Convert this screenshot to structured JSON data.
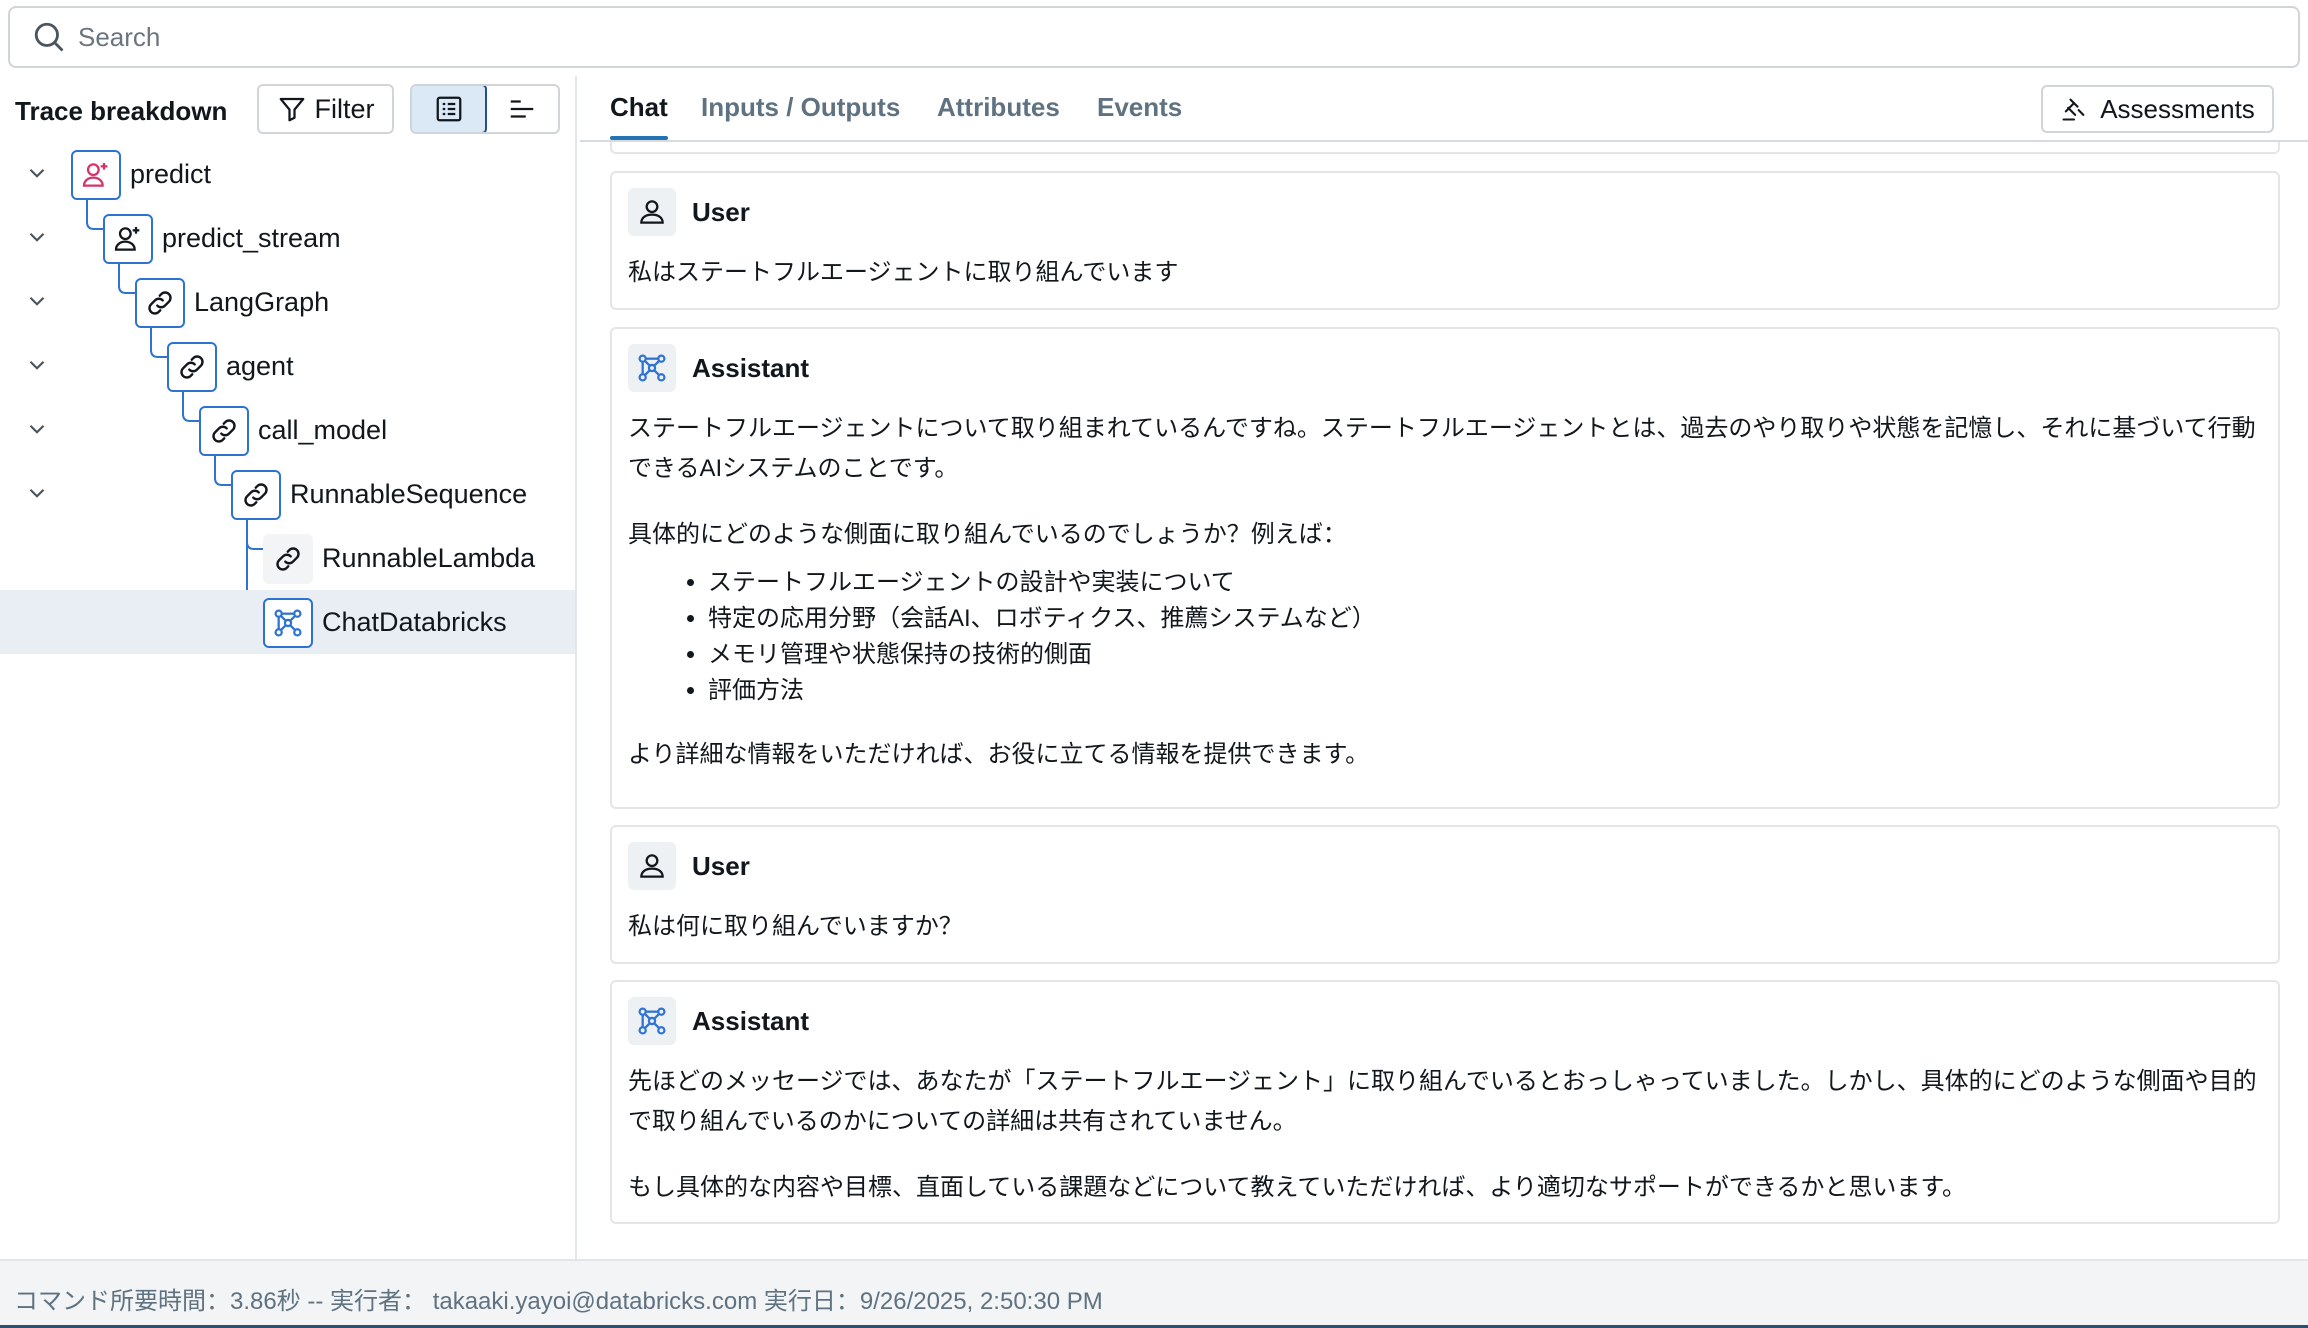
{
  "search": {
    "placeholder": "Search"
  },
  "left_panel": {
    "title": "Trace breakdown",
    "filter_label": "Filter",
    "view_modes": [
      "tree-view",
      "timeline-view"
    ]
  },
  "tree": [
    {
      "label": "predict",
      "icon": "agent-icon",
      "expanded": true
    },
    {
      "label": "predict_stream",
      "icon": "agent-icon",
      "expanded": true
    },
    {
      "label": "LangGraph",
      "icon": "link-icon",
      "expanded": true
    },
    {
      "label": "agent",
      "icon": "link-icon",
      "expanded": true
    },
    {
      "label": "call_model",
      "icon": "link-icon",
      "expanded": true
    },
    {
      "label": "RunnableSequence",
      "icon": "link-icon",
      "expanded": true
    },
    {
      "label": "RunnableLambda",
      "icon": "link-icon"
    },
    {
      "label": "ChatDatabricks",
      "icon": "model-icon",
      "selected": true
    }
  ],
  "tabs": [
    {
      "label": "Chat",
      "active": true
    },
    {
      "label": "Inputs / Outputs"
    },
    {
      "label": "Attributes"
    },
    {
      "label": "Events"
    }
  ],
  "assessments_label": "Assessments",
  "messages": [
    {
      "role": "User",
      "paragraphs": [
        "私はステートフルエージェントに取り組んでいます"
      ]
    },
    {
      "role": "Assistant",
      "paragraphs": [
        "ステートフルエージェントについて取り組まれているんですね。ステートフルエージェントとは、過去のやり取りや状態を記憶し、それに基づいて行動できるAIシステムのことです。",
        "具体的にどのような側面に取り組んでいるのでしょうか？例えば："
      ],
      "bullets": [
        "ステートフルエージェントの設計や実装について",
        "特定の応用分野（会話AI、ロボティクス、推薦システムなど）",
        "メモリ管理や状態保持の技術的側面",
        "評価方法"
      ],
      "closing": "より詳細な情報をいただければ、お役に立てる情報を提供できます。"
    },
    {
      "role": "User",
      "paragraphs": [
        "私は何に取り組んでいますか？"
      ]
    },
    {
      "role": "Assistant",
      "paragraphs": [
        "先ほどのメッセージでは、あなたが「ステートフルエージェント」に取り組んでいるとおっしゃっていました。しかし、具体的にどのような側面や目的で取り組んでいるのかについての詳細は共有されていません。",
        "もし具体的な内容や目標、直面している課題などについて教えていただければ、より適切なサポートができるかと思います。"
      ]
    }
  ],
  "footer": {
    "text": "コマンド所要時間：3.86秒 -- 実行者： takaaki.yayoi@databricks.com 実行日：9/26/2025, 2:50:30 PM"
  },
  "colors": {
    "accent": "#2272b4",
    "node_border": "#2e72d2",
    "selected_row": "#e8eef4",
    "agent_icon": "#d6336c"
  }
}
